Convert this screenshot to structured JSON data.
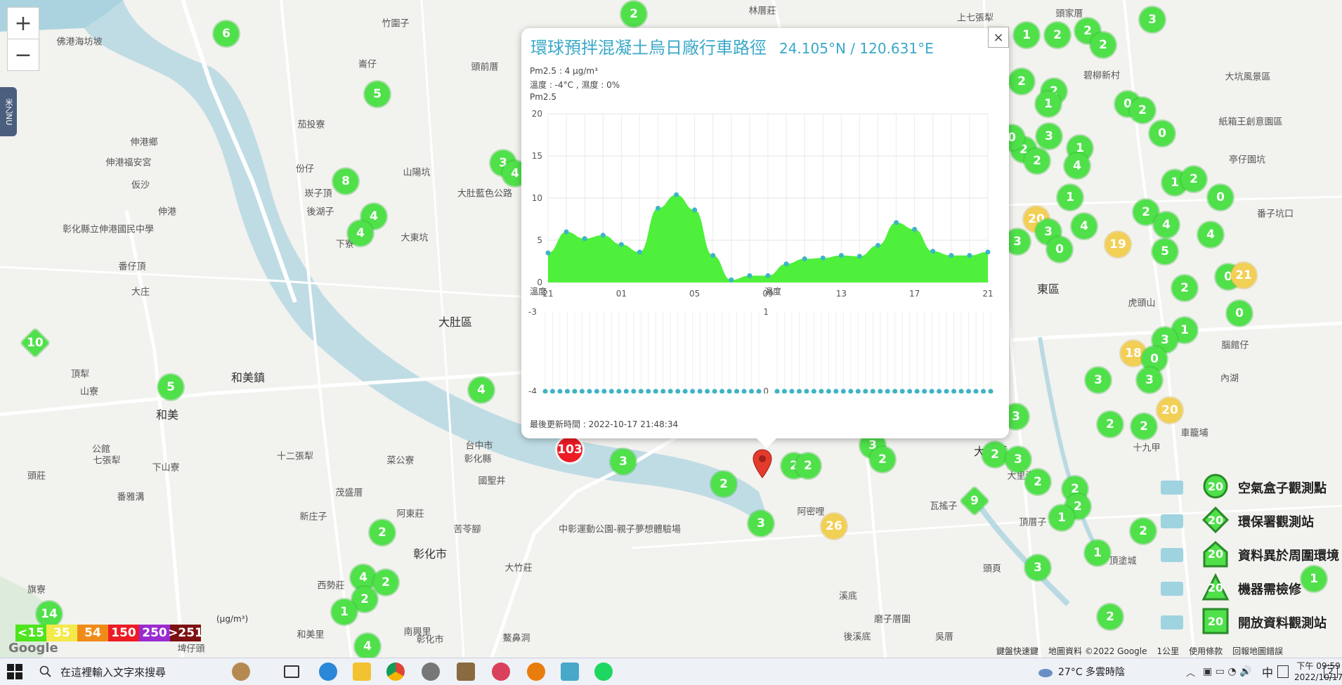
{
  "map": {
    "zoom_in": "+",
    "zoom_out": "−",
    "side_tab": "米乙NU",
    "google_logo": "Google",
    "places": [
      {
        "t": "竹圍子",
        "x": 563,
        "y": 32
      },
      {
        "t": "林厝莊",
        "x": 1085,
        "y": 14
      },
      {
        "t": "上七張犁",
        "x": 1388,
        "y": 24
      },
      {
        "t": "頭家厝",
        "x": 1522,
        "y": 18
      },
      {
        "t": "佛港海坊坡",
        "x": 113,
        "y": 58
      },
      {
        "t": "崙仔",
        "x": 523,
        "y": 90
      },
      {
        "t": "頭前厝",
        "x": 690,
        "y": 94
      },
      {
        "t": "碧柳新村",
        "x": 1568,
        "y": 106
      },
      {
        "t": "大坑風景區",
        "x": 1776,
        "y": 108
      },
      {
        "t": "茄投寮",
        "x": 443,
        "y": 176
      },
      {
        "t": "伸港鄉",
        "x": 205,
        "y": 201
      },
      {
        "t": "伸港福安宮",
        "x": 183,
        "y": 230
      },
      {
        "t": "紙箱王創意園區",
        "x": 1780,
        "y": 172
      },
      {
        "t": "仮沙",
        "x": 200,
        "y": 262
      },
      {
        "t": "份仔",
        "x": 434,
        "y": 239
      },
      {
        "t": "山陽坑",
        "x": 593,
        "y": 244
      },
      {
        "t": "大肚藍色公路",
        "x": 690,
        "y": 274
      },
      {
        "t": "亭仔園坑",
        "x": 1775,
        "y": 226
      },
      {
        "t": "崁子頂",
        "x": 453,
        "y": 274
      },
      {
        "t": "後湖子",
        "x": 456,
        "y": 300
      },
      {
        "t": "伸港",
        "x": 238,
        "y": 300
      },
      {
        "t": "大東坑",
        "x": 590,
        "y": 337
      },
      {
        "t": "彰化縣立伸港國民中學",
        "x": 154,
        "y": 325
      },
      {
        "t": "下寮",
        "x": 491,
        "y": 346
      },
      {
        "t": "番子坑口",
        "x": 1815,
        "y": 303
      },
      {
        "t": "大肚區",
        "x": 648,
        "y": 457,
        "big": true
      },
      {
        "t": "東區",
        "x": 1492,
        "y": 410,
        "big": true
      },
      {
        "t": "大庄",
        "x": 200,
        "y": 414
      },
      {
        "t": "番仔頂",
        "x": 188,
        "y": 378
      },
      {
        "t": "虎頭山",
        "x": 1625,
        "y": 430
      },
      {
        "t": "和美鎮",
        "x": 353,
        "y": 536,
        "big": true
      },
      {
        "t": "和美",
        "x": 238,
        "y": 589,
        "big": true
      },
      {
        "t": "山寮",
        "x": 127,
        "y": 556
      },
      {
        "t": "頂犁",
        "x": 114,
        "y": 531
      },
      {
        "t": "公館",
        "x": 144,
        "y": 638
      },
      {
        "t": "七張犁",
        "x": 152,
        "y": 654
      },
      {
        "t": "頭莊",
        "x": 52,
        "y": 676
      },
      {
        "t": "番雅溝",
        "x": 186,
        "y": 706
      },
      {
        "t": "下山寮",
        "x": 236,
        "y": 664
      },
      {
        "t": "十二張犁",
        "x": 420,
        "y": 648
      },
      {
        "t": "茂盛厝",
        "x": 497,
        "y": 700
      },
      {
        "t": "新庄子",
        "x": 446,
        "y": 734
      },
      {
        "t": "阿東莊",
        "x": 584,
        "y": 730
      },
      {
        "t": "菜公寮",
        "x": 570,
        "y": 654
      },
      {
        "t": "國聖井",
        "x": 700,
        "y": 683
      },
      {
        "t": "台中市",
        "x": 682,
        "y": 633
      },
      {
        "t": "彰化縣",
        "x": 680,
        "y": 652
      },
      {
        "t": "彰化市",
        "x": 612,
        "y": 787,
        "big": true
      },
      {
        "t": "苦苓腳",
        "x": 665,
        "y": 752
      },
      {
        "t": "大竹莊",
        "x": 738,
        "y": 807
      },
      {
        "t": "中彰運動公園-親子夢想體驗場",
        "x": 882,
        "y": 752
      },
      {
        "t": "阿密哩",
        "x": 1154,
        "y": 727
      },
      {
        "t": "瓦搖子",
        "x": 1343,
        "y": 719
      },
      {
        "t": "頂厝子",
        "x": 1470,
        "y": 742
      },
      {
        "t": "大里溪",
        "x": 1453,
        "y": 676
      },
      {
        "t": "十九甲",
        "x": 1632,
        "y": 636
      },
      {
        "t": "車籠埔",
        "x": 1700,
        "y": 615
      },
      {
        "t": "頂塗城",
        "x": 1598,
        "y": 797
      },
      {
        "t": "溪底",
        "x": 1207,
        "y": 847
      },
      {
        "t": "磨子厝圍",
        "x": 1270,
        "y": 880
      },
      {
        "t": "吳厝",
        "x": 1344,
        "y": 905
      },
      {
        "t": "後溪底",
        "x": 1220,
        "y": 905
      },
      {
        "t": "和美里",
        "x": 442,
        "y": 902
      },
      {
        "t": "南興里",
        "x": 594,
        "y": 898
      },
      {
        "t": "彰化市",
        "x": 612,
        "y": 909
      },
      {
        "t": "旗寮",
        "x": 52,
        "y": 838
      },
      {
        "t": "西勢莊",
        "x": 471,
        "y": 832
      },
      {
        "t": "鰲鼻洞",
        "x": 735,
        "y": 907
      },
      {
        "t": "埤仔頭",
        "x": 272,
        "y": 922
      },
      {
        "t": "頭頁",
        "x": 1412,
        "y": 808
      },
      {
        "t": "大里區",
        "x": 1410,
        "y": 641,
        "big": true
      },
      {
        "t": "內湖",
        "x": 1750,
        "y": 537
      },
      {
        "t": "腦館仔",
        "x": 1758,
        "y": 490
      }
    ],
    "markers": [
      {
        "v": "6",
        "x": 322,
        "y": 48,
        "c": "green"
      },
      {
        "v": "5",
        "x": 537,
        "y": 134,
        "c": "green"
      },
      {
        "v": "8",
        "x": 492,
        "y": 258,
        "c": "green"
      },
      {
        "v": "4",
        "x": 532,
        "y": 308,
        "c": "green"
      },
      {
        "v": "4",
        "x": 513,
        "y": 332,
        "c": "green"
      },
      {
        "v": "3",
        "x": 716,
        "y": 232,
        "c": "green"
      },
      {
        "v": "4",
        "x": 733,
        "y": 247,
        "c": "green"
      },
      {
        "v": "10",
        "x": 50,
        "y": 488,
        "c": "green",
        "d": true
      },
      {
        "v": "5",
        "x": 243,
        "y": 551,
        "c": "green"
      },
      {
        "v": "4",
        "x": 685,
        "y": 555,
        "c": "green"
      },
      {
        "v": "103",
        "x": 811,
        "y": 640,
        "c": "red"
      },
      {
        "v": "3",
        "x": 887,
        "y": 657,
        "c": "green"
      },
      {
        "v": "2",
        "x": 1030,
        "y": 689,
        "c": "green"
      },
      {
        "v": "2",
        "x": 1130,
        "y": 663,
        "c": "green"
      },
      {
        "v": "3",
        "x": 1083,
        "y": 745,
        "c": "green"
      },
      {
        "v": "26",
        "x": 1187,
        "y": 749,
        "c": "yellow"
      },
      {
        "v": "3",
        "x": 1242,
        "y": 634,
        "c": "green"
      },
      {
        "v": "2",
        "x": 1256,
        "y": 654,
        "c": "green"
      },
      {
        "v": "9",
        "x": 1387,
        "y": 713,
        "c": "green",
        "d": true
      },
      {
        "v": "2",
        "x": 544,
        "y": 758,
        "c": "green"
      },
      {
        "v": "4",
        "x": 517,
        "y": 822,
        "c": "green"
      },
      {
        "v": "2",
        "x": 549,
        "y": 829,
        "c": "green"
      },
      {
        "v": "2",
        "x": 519,
        "y": 853,
        "c": "green"
      },
      {
        "v": "1",
        "x": 490,
        "y": 871,
        "c": "green"
      },
      {
        "v": "14",
        "x": 70,
        "y": 874,
        "c": "green"
      },
      {
        "v": "4",
        "x": 523,
        "y": 920,
        "c": "green"
      },
      {
        "v": "2",
        "x": 902,
        "y": 20,
        "c": "green"
      },
      {
        "v": "1",
        "x": 1461,
        "y": 50,
        "c": "green"
      },
      {
        "v": "2",
        "x": 1505,
        "y": 50,
        "c": "green"
      },
      {
        "v": "2",
        "x": 1548,
        "y": 44,
        "c": "green"
      },
      {
        "v": "2",
        "x": 1570,
        "y": 64,
        "c": "green"
      },
      {
        "v": "3",
        "x": 1640,
        "y": 28,
        "c": "green"
      },
      {
        "v": "2",
        "x": 1454,
        "y": 116,
        "c": "green"
      },
      {
        "v": "2",
        "x": 1500,
        "y": 130,
        "c": "green"
      },
      {
        "v": "1",
        "x": 1492,
        "y": 148,
        "c": "green"
      },
      {
        "v": "0",
        "x": 1605,
        "y": 148,
        "c": "green"
      },
      {
        "v": "2",
        "x": 1626,
        "y": 157,
        "c": "green"
      },
      {
        "v": "0",
        "x": 1654,
        "y": 190,
        "c": "green"
      },
      {
        "v": "3",
        "x": 1493,
        "y": 194,
        "c": "green"
      },
      {
        "v": "1",
        "x": 1537,
        "y": 211,
        "c": "green"
      },
      {
        "v": "2",
        "x": 1457,
        "y": 213,
        "c": "green"
      },
      {
        "v": "2",
        "x": 1476,
        "y": 229,
        "c": "green"
      },
      {
        "v": "4",
        "x": 1533,
        "y": 236,
        "c": "green"
      },
      {
        "v": "1",
        "x": 1672,
        "y": 260,
        "c": "green"
      },
      {
        "v": "2",
        "x": 1699,
        "y": 255,
        "c": "green"
      },
      {
        "v": "0",
        "x": 1737,
        "y": 281,
        "c": "green"
      },
      {
        "v": "1",
        "x": 1523,
        "y": 281,
        "c": "green"
      },
      {
        "v": "20",
        "x": 1475,
        "y": 312,
        "c": "yellow"
      },
      {
        "v": "2",
        "x": 1631,
        "y": 302,
        "c": "green"
      },
      {
        "v": "3",
        "x": 1492,
        "y": 330,
        "c": "green"
      },
      {
        "v": "4",
        "x": 1543,
        "y": 322,
        "c": "green"
      },
      {
        "v": "0",
        "x": 1508,
        "y": 355,
        "c": "green"
      },
      {
        "v": "4",
        "x": 1660,
        "y": 320,
        "c": "green"
      },
      {
        "v": "4",
        "x": 1723,
        "y": 334,
        "c": "green"
      },
      {
        "v": "19",
        "x": 1591,
        "y": 348,
        "c": "yellow"
      },
      {
        "v": "5",
        "x": 1658,
        "y": 358,
        "c": "green"
      },
      {
        "v": "3",
        "x": 1448,
        "y": 344,
        "c": "green"
      },
      {
        "v": "0",
        "x": 1748,
        "y": 394,
        "c": "green"
      },
      {
        "v": "21",
        "x": 1770,
        "y": 392,
        "c": "yellow"
      },
      {
        "v": "2",
        "x": 1686,
        "y": 410,
        "c": "green"
      },
      {
        "v": "1",
        "x": 1686,
        "y": 470,
        "c": "green"
      },
      {
        "v": "3",
        "x": 1658,
        "y": 484,
        "c": "green"
      },
      {
        "v": "0",
        "x": 1764,
        "y": 446,
        "c": "green"
      },
      {
        "v": "18",
        "x": 1613,
        "y": 503,
        "c": "yellow"
      },
      {
        "v": "0",
        "x": 1643,
        "y": 511,
        "c": "green"
      },
      {
        "v": "3",
        "x": 1563,
        "y": 541,
        "c": "green"
      },
      {
        "v": "3",
        "x": 1636,
        "y": 541,
        "c": "green"
      },
      {
        "v": "20",
        "x": 1665,
        "y": 584,
        "c": "yellow"
      },
      {
        "v": "2",
        "x": 1580,
        "y": 604,
        "c": "green"
      },
      {
        "v": "2",
        "x": 1628,
        "y": 607,
        "c": "green"
      },
      {
        "v": "3",
        "x": 1446,
        "y": 593,
        "c": "green"
      },
      {
        "v": "2",
        "x": 1416,
        "y": 647,
        "c": "green"
      },
      {
        "v": "3",
        "x": 1449,
        "y": 654,
        "c": "green"
      },
      {
        "v": "2",
        "x": 1477,
        "y": 686,
        "c": "green"
      },
      {
        "v": "2",
        "x": 1530,
        "y": 696,
        "c": "green"
      },
      {
        "v": "2",
        "x": 1534,
        "y": 721,
        "c": "green"
      },
      {
        "v": "1",
        "x": 1511,
        "y": 737,
        "c": "green"
      },
      {
        "v": "2",
        "x": 1627,
        "y": 756,
        "c": "green"
      },
      {
        "v": "1",
        "x": 1562,
        "y": 787,
        "c": "green"
      },
      {
        "v": "3",
        "x": 1477,
        "y": 808,
        "c": "green"
      },
      {
        "v": "2",
        "x": 1580,
        "y": 878,
        "c": "green"
      },
      {
        "v": "1",
        "x": 1870,
        "y": 824,
        "c": "green"
      },
      {
        "v": "0",
        "x": 1440,
        "y": 196,
        "c": "green"
      },
      {
        "v": "2",
        "x": 1150,
        "y": 663,
        "c": "green"
      }
    ]
  },
  "popup": {
    "title": "環球預拌混凝土烏日廠行車路徑",
    "coord": "24.105°N / 120.631°E",
    "close": "×",
    "pm_value": "Pm2.5 : 4 μg/m³",
    "temp_humidity": "溫度 : -4°C , 濕度 : 0%",
    "last_update": "最後更新時間 : 2022-10-17 21:48:34"
  },
  "chart_data": [
    {
      "type": "area",
      "title": "Pm2.5",
      "y_ticks": [
        "20",
        "15",
        "10",
        "5",
        "0"
      ],
      "ylim": [
        0,
        20
      ],
      "x_ticks": [
        "21",
        "01",
        "05",
        "09",
        "13",
        "17",
        "21"
      ],
      "x_hours": [
        21,
        22,
        23,
        0,
        1,
        2,
        3,
        4,
        5,
        6,
        7,
        8,
        9,
        10,
        11,
        12,
        13,
        14,
        15,
        16,
        17,
        18,
        19,
        20,
        21
      ],
      "values": [
        3.5,
        6.0,
        5.2,
        5.6,
        4.5,
        3.6,
        8.8,
        10.4,
        8.6,
        3.2,
        0.3,
        0.8,
        0.8,
        2.2,
        2.8,
        2.9,
        3.2,
        3.1,
        4.4,
        7.1,
        6.3,
        3.7,
        3.2,
        3.2,
        3.6
      ],
      "color": "#4ef03c",
      "grid": true
    },
    {
      "type": "scatter",
      "title": "溫度",
      "y_ticks": [
        "-3",
        "-4"
      ],
      "ylim": [
        -4,
        -3
      ],
      "count": 30,
      "value": -4,
      "color": "#3fb3c6"
    },
    {
      "type": "scatter",
      "title": "濕度",
      "y_ticks": [
        "1",
        "0"
      ],
      "ylim": [
        0,
        1
      ],
      "count": 30,
      "value": 0,
      "color": "#3fb3c6"
    }
  ],
  "legend": {
    "unit": "(μg/m³)",
    "items": [
      {
        "label": "<15",
        "color": "#4ee41e"
      },
      {
        "label": "35",
        "color": "#f3e94a"
      },
      {
        "label": "54",
        "color": "#f08b19"
      },
      {
        "label": "150",
        "color": "#ec1b24"
      },
      {
        "label": "250",
        "color": "#9b2bd0"
      },
      {
        "label": ">251",
        "color": "#7d1010"
      }
    ]
  },
  "stations": [
    {
      "label": "空氣盒子觀測點",
      "badge": "20",
      "shape": "circle"
    },
    {
      "label": "環保署觀測站",
      "badge": "20",
      "shape": "diamond"
    },
    {
      "label": "資料異於周圍環境",
      "badge": "20",
      "shape": "house"
    },
    {
      "label": "機器需檢修",
      "badge": "20",
      "shape": "triangle"
    },
    {
      "label": "開放資料觀測站",
      "badge": "20",
      "shape": "square"
    }
  ],
  "attribution": [
    "鍵盤快速鍵",
    "地圖資料 ©2022 Google",
    "1公里",
    "使用條款",
    "回報地圖錯誤"
  ],
  "taskbar": {
    "search_placeholder": "在這裡輸入文字來搜尋",
    "weather": "27°C 多雲時陰",
    "ime": "中",
    "time": "下午 09:59",
    "date": "2022/10/17",
    "notif_count": "2"
  }
}
